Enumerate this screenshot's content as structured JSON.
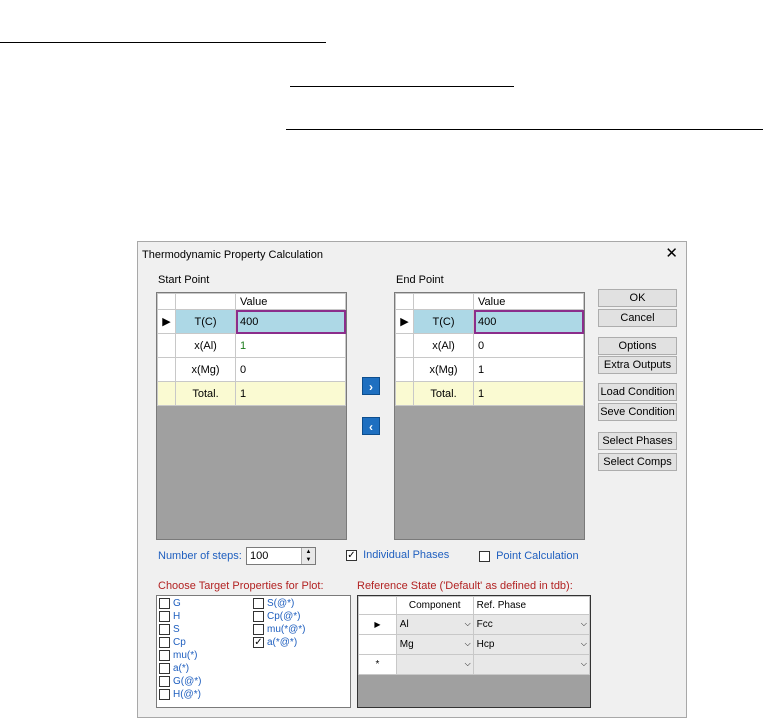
{
  "dialog": {
    "title": "Thermodynamic Property Calculation",
    "close_glyph": "✕",
    "start_label": "Start Point",
    "end_label": "End Point",
    "value_header": "Value",
    "start_rows": [
      {
        "name": "T(C)",
        "value": "400"
      },
      {
        "name": "x(Al)",
        "value": "1"
      },
      {
        "name": "x(Mg)",
        "value": "0"
      },
      {
        "name": "Total.",
        "value": "1"
      }
    ],
    "end_rows": [
      {
        "name": "T(C)",
        "value": "400"
      },
      {
        "name": "x(Al)",
        "value": "0"
      },
      {
        "name": "x(Mg)",
        "value": "1"
      },
      {
        "name": "Total.",
        "value": "1"
      }
    ],
    "buttons": {
      "ok": "OK",
      "cancel": "Cancel",
      "options": "Options",
      "extra_outputs": "Extra Outputs",
      "load_condition": "Load Condition",
      "save_condition": "Seve Condition",
      "select_phases": "Select Phases",
      "select_comps": "Select Comps"
    },
    "steps_label": "Number of steps:",
    "steps_value": "100",
    "individual_phases_label": "Individual Phases",
    "individual_phases_checked": true,
    "point_calc_label": "Point Calculation",
    "point_calc_checked": false,
    "props_title": "Choose Target Properties for Plot:",
    "props_col1": [
      "G",
      "H",
      "S",
      "Cp",
      "mu(*)",
      "a(*)",
      "G(@*)",
      "H(@*)"
    ],
    "props_col2": [
      "S(@*)",
      "Cp(@*)",
      "mu(*@*)",
      "a(*@*)"
    ],
    "props_col2_checked": [
      false,
      false,
      false,
      true
    ],
    "ref_title": "Reference State ('Default' as defined in tdb):",
    "ref_headers": [
      "Component",
      "Ref. Phase"
    ],
    "ref_rows": [
      {
        "component": "Al",
        "phase": "Fcc"
      },
      {
        "component": "Mg",
        "phase": "Hcp"
      },
      {
        "component": "",
        "phase": ""
      }
    ]
  }
}
